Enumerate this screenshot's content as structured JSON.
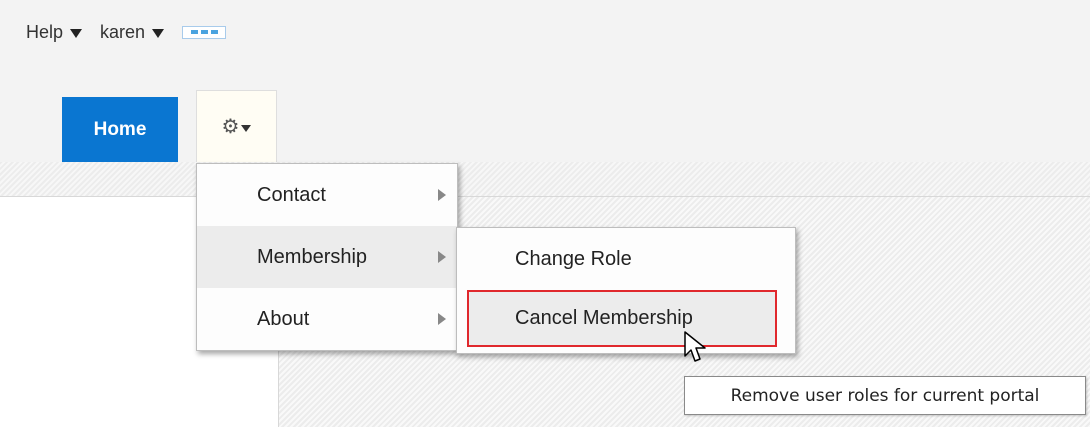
{
  "topnav": {
    "help_label": "Help",
    "user_label": "karen"
  },
  "tabs": {
    "home_label": "Home",
    "gear_icon": "gear-icon"
  },
  "menu": {
    "items": [
      {
        "label": "Contact",
        "has_submenu": true
      },
      {
        "label": "Membership",
        "has_submenu": true,
        "active": true
      },
      {
        "label": "About",
        "has_submenu": true
      }
    ]
  },
  "submenu": {
    "items": [
      {
        "label": "Change Role"
      },
      {
        "label": "Cancel Membership",
        "highlighted": true
      }
    ]
  },
  "tooltip": {
    "text": "Remove user roles for current portal"
  },
  "colors": {
    "accent": "#0a76d1",
    "highlight": "#e0282d"
  }
}
